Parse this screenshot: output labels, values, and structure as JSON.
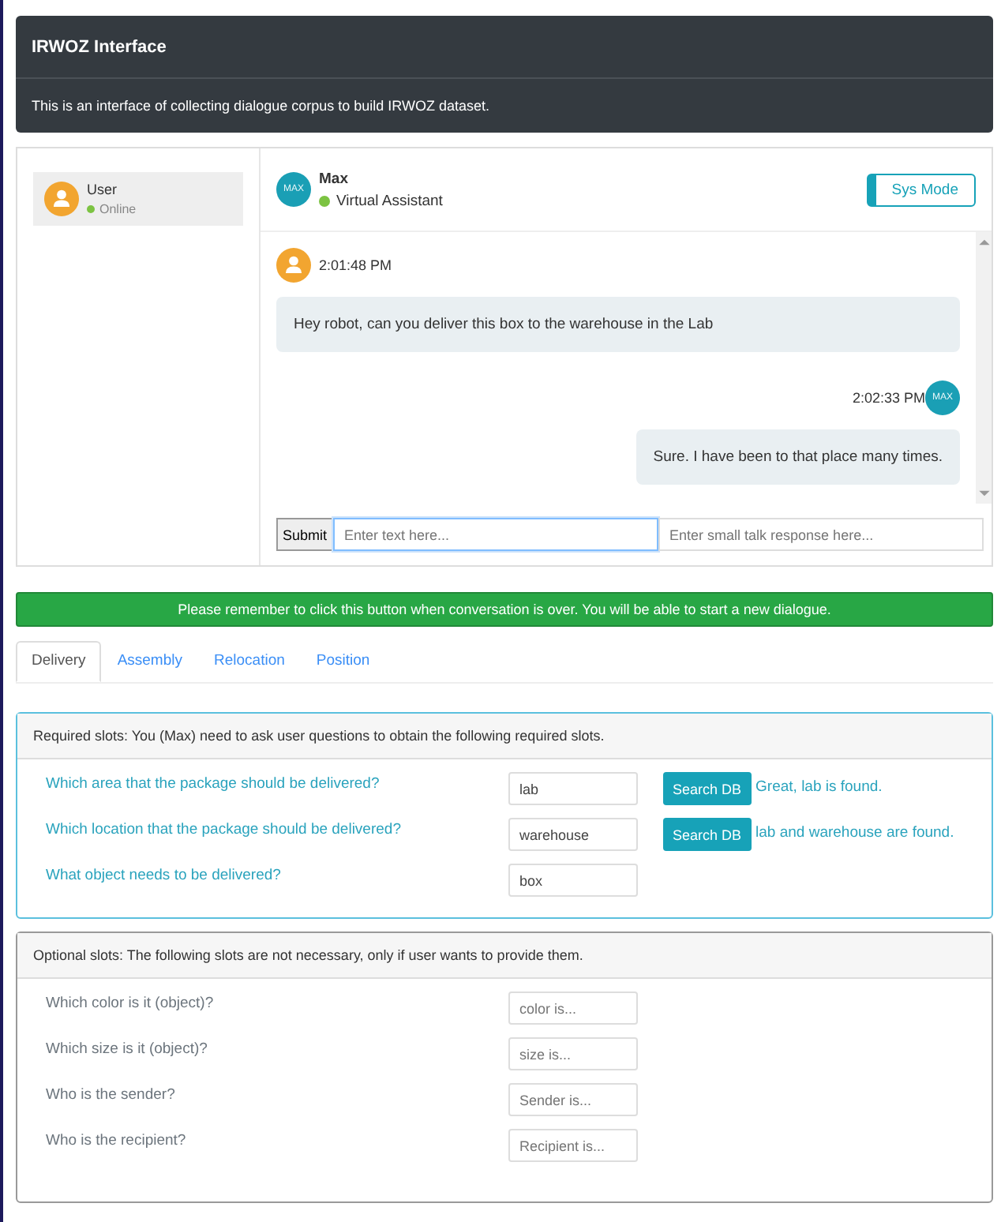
{
  "header": {
    "title": "IRWOZ Interface",
    "subtitle": "This is an interface of collecting dialogue corpus to build IRWOZ dataset."
  },
  "contacts": [
    {
      "name": "User",
      "status": "Online",
      "selected": true
    }
  ],
  "chat_header": {
    "avatar": "MAX",
    "name": "Max",
    "role": "Virtual Assistant",
    "mode_button": "Sys Mode"
  },
  "messages": [
    {
      "kind": "user",
      "time": "2:01:48 PM",
      "text": "Hey robot, can you deliver this box to the warehouse in the Lab"
    },
    {
      "kind": "bot",
      "avatar": "MAX",
      "time": "2:02:33 PM",
      "text": "Sure. I have been to that place many times."
    }
  ],
  "composer": {
    "submit": "Submit",
    "placeholder": "Enter text here...",
    "small_talk_placeholder": "Enter small talk response here..."
  },
  "end_button": "Please remember to click this button when conversation is over. You will be able to start a new dialogue.",
  "tabs": [
    {
      "label": "Delivery",
      "selected": true
    },
    {
      "label": "Assembly",
      "selected": false
    },
    {
      "label": "Relocation",
      "selected": false
    },
    {
      "label": "Position",
      "selected": false
    }
  ],
  "required": {
    "heading": "Required slots: You (Max) need to ask user questions to obtain the following required slots.",
    "slots": [
      {
        "question": "Which area that the package should be delivered?",
        "value": "lab",
        "button": "Search DB",
        "result": "Great, lab is found."
      },
      {
        "question": "Which location that the package should be delivered?",
        "value": "warehouse",
        "button": "Search DB",
        "result": "lab and warehouse are found."
      },
      {
        "question": "What object needs to be delivered?",
        "value": "box"
      }
    ]
  },
  "optional": {
    "heading": "Optional slots: The following slots are not necessary, only if user wants to provide them.",
    "slots": [
      {
        "question": "Which color is it (object)?",
        "placeholder": "color is..."
      },
      {
        "question": "Which size is it (object)?",
        "placeholder": "size is..."
      },
      {
        "question": "Who is the sender?",
        "placeholder": "Sender is..."
      },
      {
        "question": "Who is the recipient?",
        "placeholder": "Recipient is..."
      }
    ]
  }
}
